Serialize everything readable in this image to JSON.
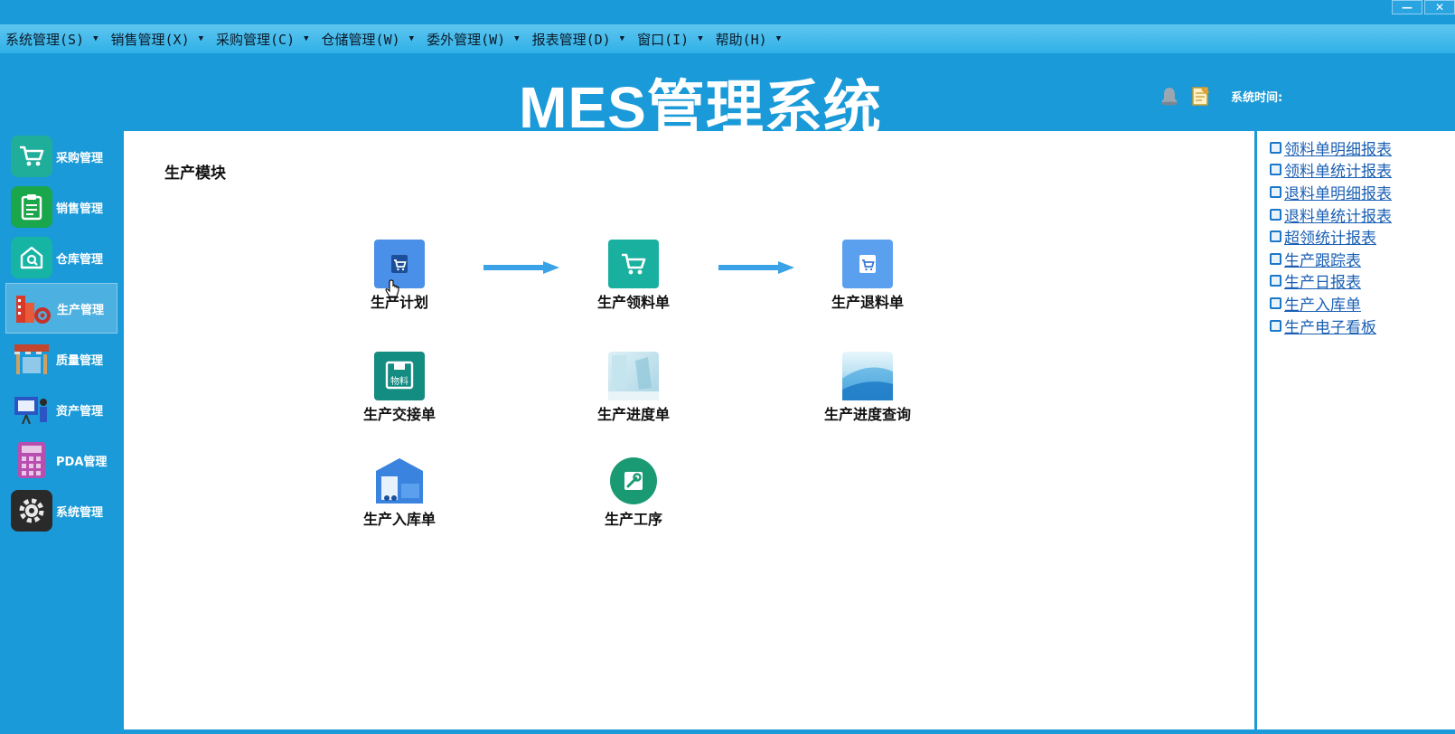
{
  "window": {
    "minimize_glyph": "—",
    "close_glyph": "✕"
  },
  "menubar": {
    "items": [
      {
        "label": "系统管理(S)"
      },
      {
        "label": "销售管理(X)"
      },
      {
        "label": "采购管理(C)"
      },
      {
        "label": "仓储管理(W)"
      },
      {
        "label": "委外管理(W)"
      },
      {
        "label": "报表管理(D)"
      },
      {
        "label": "窗口(I)"
      },
      {
        "label": "帮助(H)"
      }
    ],
    "caret_glyph": "▼"
  },
  "header": {
    "title": "MES管理系统",
    "system_time_label": "系统时间:",
    "icons": [
      "bell-icon",
      "memo-icon"
    ]
  },
  "sidebar": {
    "items": [
      {
        "label": "采购管理",
        "icon": "cart-icon",
        "color": "#1fae9a"
      },
      {
        "label": "销售管理",
        "icon": "clipboard-icon",
        "color": "#1aa64a"
      },
      {
        "label": "仓库管理",
        "icon": "warehouse-icon",
        "color": "#15b4a4"
      },
      {
        "label": "生产管理",
        "icon": "factory-icon",
        "color": "#d83a2a",
        "active": true
      },
      {
        "label": "质量管理",
        "icon": "shop-icon",
        "color": "#c2452e"
      },
      {
        "label": "资产管理",
        "icon": "presentation-icon",
        "color": "#2a56c4"
      },
      {
        "label": "PDA管理",
        "icon": "calculator-icon",
        "color": "#b84fb0"
      },
      {
        "label": "系统管理",
        "icon": "gear-icon",
        "color": "#2a2a2a"
      }
    ]
  },
  "main": {
    "module_title": "生产模块",
    "tiles": [
      {
        "label": "生产计划",
        "icon": "cart-icon",
        "color": "#4a8fe8"
      },
      {
        "label": "生产领料单",
        "icon": "cart-icon",
        "color": "#1ab0a0"
      },
      {
        "label": "生产退料单",
        "icon": "cart-icon",
        "color": "#5aa0ee"
      },
      {
        "label": "生产交接单",
        "icon": "material-box-icon",
        "color": "#138c82",
        "badge": "物料"
      },
      {
        "label": "生产进度单",
        "icon": "image-thumbnail-icon",
        "color": "#b8dce8"
      },
      {
        "label": "生产进度查询",
        "icon": "image-thumbnail-icon",
        "color": "#3c9ad8"
      },
      {
        "label": "生产入库单",
        "icon": "warehouse-truck-icon",
        "color": "#3a84e0"
      },
      {
        "label": "生产工序",
        "icon": "wrench-icon",
        "color": "#1a9a72"
      }
    ],
    "flow_arrow_color": "#3aa2e6"
  },
  "reports": {
    "links": [
      {
        "label": "领料单明细报表"
      },
      {
        "label": "领料单统计报表"
      },
      {
        "label": "退料单明细报表"
      },
      {
        "label": "退料单统计报表"
      },
      {
        "label": "超领统计报表"
      },
      {
        "label": "生产跟踪表"
      },
      {
        "label": "生产日报表"
      },
      {
        "label": "生产入库单"
      },
      {
        "label": "生产电子看板"
      }
    ]
  }
}
